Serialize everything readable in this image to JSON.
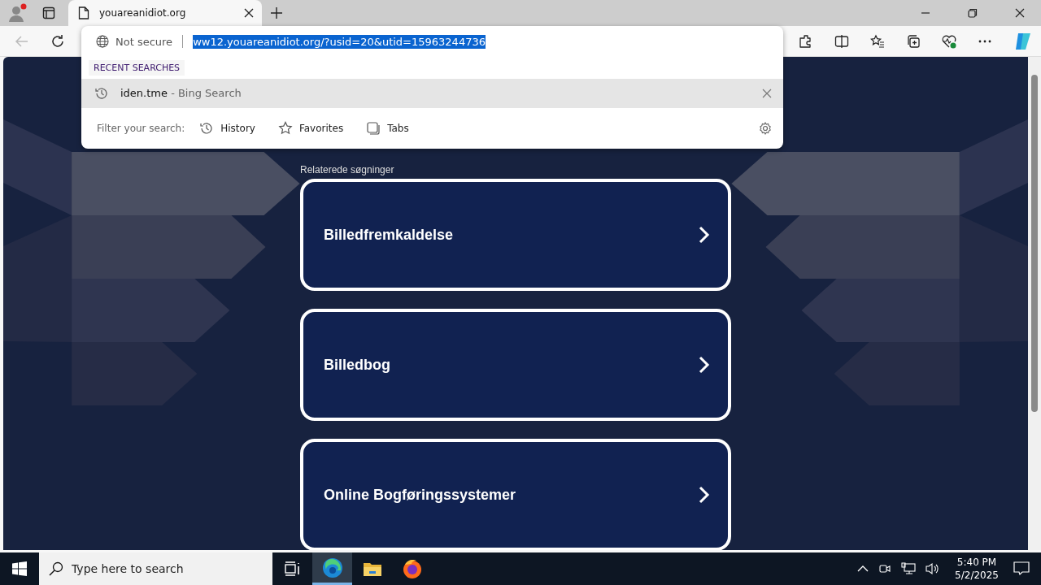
{
  "tab": {
    "title": "youareanidiot.org"
  },
  "address": {
    "security": "Not secure",
    "url": "ww12.youareanidiot.org/?usid=20&utid=15963244736"
  },
  "suggestions": {
    "header": "RECENT SEARCHES",
    "items": [
      {
        "query": "iden.tme",
        "suffix": "- Bing Search",
        "selected": true
      }
    ],
    "filter_label": "Filter your search:",
    "filters": [
      {
        "label": "History",
        "kind": "history"
      },
      {
        "label": "Favorites",
        "kind": "favorites"
      },
      {
        "label": "Tabs",
        "kind": "tabs"
      }
    ]
  },
  "page": {
    "related_label": "Relaterede søgninger",
    "cards": [
      {
        "label": "Billedfremkaldelse"
      },
      {
        "label": "Billedbog"
      },
      {
        "label": "Online Bogføringssystemer"
      }
    ]
  },
  "taskbar": {
    "search_placeholder": "Type here to search",
    "apps": [
      {
        "kind": "taskview",
        "selected": false
      },
      {
        "kind": "edge",
        "selected": true
      },
      {
        "kind": "explorer",
        "selected": false
      },
      {
        "kind": "firefox",
        "selected": false
      }
    ],
    "time": "5:40 PM",
    "date": "5/2/2025"
  }
}
